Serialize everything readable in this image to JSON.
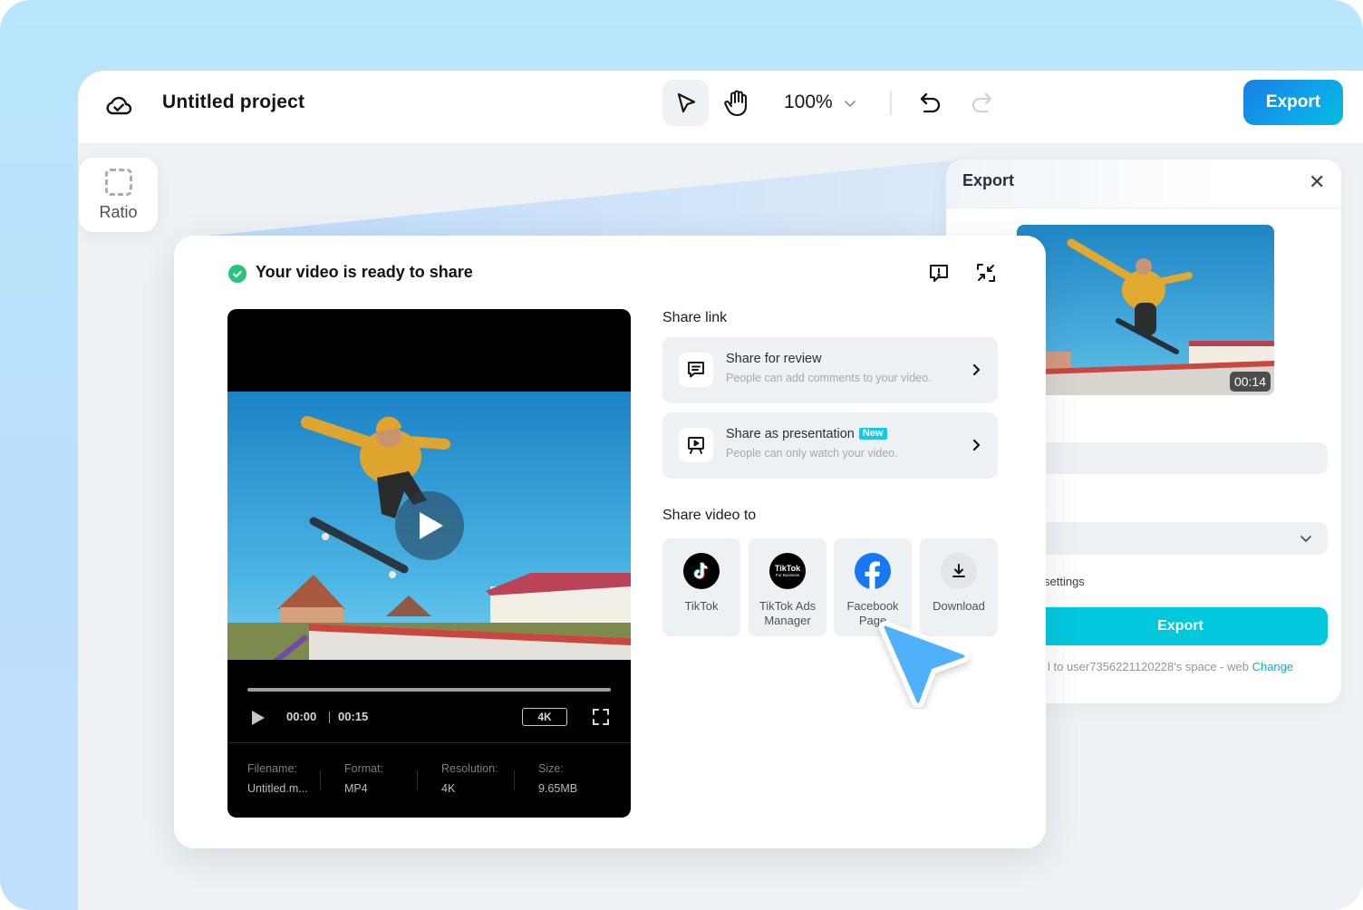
{
  "topbar": {
    "project_title": "Untitled project",
    "zoom_level": "100%",
    "export_label": "Export"
  },
  "left_tools": {
    "ratio_label": "Ratio"
  },
  "export_panel": {
    "title": "Export",
    "thumbnail_duration": "00:14",
    "settings_text": "settings",
    "export_button": "Export",
    "save_note": "l to user7356221120228's space - web",
    "change_link": "Change"
  },
  "share_modal": {
    "title": "Your video is ready to share",
    "player": {
      "current_time": "00:00",
      "total_time": "00:15",
      "quality": "4K",
      "progress": 0,
      "meta": [
        {
          "label": "Filename:",
          "value": "Untitled.m..."
        },
        {
          "label": "Format:",
          "value": "MP4"
        },
        {
          "label": "Resolution:",
          "value": "4K"
        },
        {
          "label": "Size:",
          "value": "9.65MB"
        }
      ]
    },
    "share_link_label": "Share link",
    "share_links": [
      {
        "title": "Share for review",
        "subtitle": "People can add comments to your video.",
        "badge": ""
      },
      {
        "title": "Share as presentation",
        "subtitle": "People can only watch your video.",
        "badge": "New"
      }
    ],
    "share_video_label": "Share video to",
    "destinations": [
      {
        "label": "TikTok",
        "icon": "tiktok-icon"
      },
      {
        "label": "TikTok Ads Manager",
        "icon": "tiktok-business-icon",
        "icon_text_1": "TikTok",
        "icon_text_2": "For Business"
      },
      {
        "label": "Facebook Page",
        "icon": "facebook-icon"
      },
      {
        "label": "Download",
        "icon": "download-icon"
      }
    ]
  },
  "colors": {
    "accent_blue": "#1a7fe6",
    "accent_cyan": "#00c8dd",
    "success_green": "#27c47e",
    "facebook_blue": "#1877f2",
    "cursor_blue": "#4fb1f9"
  }
}
